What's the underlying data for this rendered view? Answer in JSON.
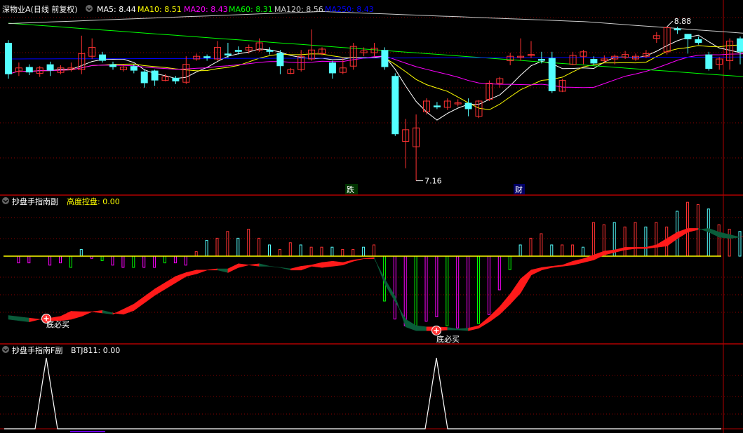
{
  "colors": {
    "up": "#ff3232",
    "down": "#54ffff",
    "ma5": "#ffffff",
    "ma10": "#ffff00",
    "ma20": "#ff00ff",
    "ma60": "#00ff00",
    "ma120": "#cccccc",
    "ma250": "#0000ff",
    "grid": "#8b0000",
    "title": "#ffffff"
  },
  "main": {
    "stock_name": "深物业A(日线 前复权)",
    "ma": [
      {
        "label": "MA5: 8.44",
        "color": "#ffffff"
      },
      {
        "label": "MA10: 8.51",
        "color": "#ffff00"
      },
      {
        "label": "MA20: 8.43",
        "color": "#ff00ff"
      },
      {
        "label": "MA60: 8.31",
        "color": "#00ff00"
      },
      {
        "label": "MA120: 8.56",
        "color": "#cccccc"
      },
      {
        "label": "MA250: 8.43",
        "color": "#0000ff"
      }
    ],
    "high_marker": "8.88",
    "low_marker": "7.16",
    "event_1": "跌",
    "event_2": "财"
  },
  "sub1": {
    "title": "抄盘手指南副",
    "value_label": "高度控盘: 0.00",
    "signal_1": "底必买",
    "signal_2": "底必买"
  },
  "sub2": {
    "title": "抄盘手指南F副",
    "value_label": "BTJ811: 0.00"
  },
  "chart_data": {
    "type": "candlestick",
    "price_range": [
      7.0,
      9.1
    ],
    "candles": [
      [
        8.7,
        8.35,
        8.73,
        8.3
      ],
      [
        8.38,
        8.42,
        8.48,
        8.33
      ],
      [
        8.43,
        8.37,
        8.46,
        8.34
      ],
      [
        8.36,
        8.42,
        8.44,
        8.32
      ],
      [
        8.46,
        8.39,
        8.49,
        8.33
      ],
      [
        8.37,
        8.42,
        8.45,
        8.35
      ],
      [
        8.4,
        8.42,
        8.48,
        8.38
      ],
      [
        8.4,
        8.58,
        8.78,
        8.35
      ],
      [
        8.55,
        8.65,
        8.75,
        8.52
      ],
      [
        8.57,
        8.5,
        8.6,
        8.48
      ],
      [
        8.46,
        8.43,
        8.49,
        8.4
      ],
      [
        8.4,
        8.43,
        8.46,
        8.38
      ],
      [
        8.44,
        8.39,
        8.46,
        8.36
      ],
      [
        8.38,
        8.25,
        8.4,
        8.2
      ],
      [
        8.39,
        8.28,
        8.4,
        8.22
      ],
      [
        8.28,
        8.32,
        8.35,
        8.27
      ],
      [
        8.31,
        8.27,
        8.33,
        8.24
      ],
      [
        8.26,
        8.46,
        8.55,
        8.24
      ],
      [
        8.52,
        8.55,
        8.58,
        8.5
      ],
      [
        8.55,
        8.53,
        8.57,
        8.5
      ],
      [
        8.52,
        8.65,
        8.72,
        8.5
      ],
      [
        8.58,
        8.56,
        8.7,
        8.53
      ],
      [
        8.62,
        8.6,
        8.66,
        8.57
      ],
      [
        8.62,
        8.65,
        8.68,
        8.58
      ],
      [
        8.62,
        8.7,
        8.75,
        8.6
      ],
      [
        8.62,
        8.6,
        8.65,
        8.57
      ],
      [
        8.59,
        8.44,
        8.62,
        8.35
      ],
      [
        8.36,
        8.4,
        8.42,
        8.35
      ],
      [
        8.4,
        8.55,
        8.62,
        8.38
      ],
      [
        8.52,
        8.62,
        8.85,
        8.5
      ],
      [
        8.58,
        8.63,
        8.65,
        8.56
      ],
      [
        8.48,
        8.36,
        8.5,
        8.3
      ],
      [
        8.37,
        8.42,
        8.53,
        8.35
      ],
      [
        8.44,
        8.66,
        8.7,
        8.4
      ],
      [
        8.59,
        8.61,
        8.65,
        8.55
      ],
      [
        8.59,
        8.64,
        8.7,
        8.55
      ],
      [
        8.62,
        8.43,
        8.65,
        8.4
      ],
      [
        8.33,
        7.68,
        8.36,
        7.66
      ],
      [
        7.6,
        7.73,
        7.85,
        7.3
      ],
      [
        7.54,
        7.75,
        7.9,
        7.16
      ],
      [
        7.93,
        8.05,
        8.08,
        7.9
      ],
      [
        8.0,
        7.98,
        8.04,
        7.96
      ],
      [
        7.98,
        8.05,
        8.08,
        7.95
      ],
      [
        8.03,
        8.03,
        8.07,
        7.99
      ],
      [
        8.03,
        7.96,
        8.08,
        7.88
      ],
      [
        7.88,
        8.05,
        8.06,
        7.86
      ],
      [
        8.07,
        8.25,
        8.28,
        8.05
      ],
      [
        8.25,
        8.3,
        8.32,
        8.2
      ],
      [
        8.5,
        8.55,
        8.59,
        8.45
      ],
      [
        8.55,
        8.55,
        8.75,
        8.5
      ],
      [
        8.56,
        8.57,
        8.72,
        8.53
      ],
      [
        8.52,
        8.5,
        8.6,
        8.47
      ],
      [
        8.53,
        8.16,
        8.6,
        8.14
      ],
      [
        8.16,
        8.28,
        8.3,
        8.15
      ],
      [
        8.46,
        8.56,
        8.6,
        8.45
      ],
      [
        8.55,
        8.6,
        8.62,
        8.46
      ],
      [
        8.52,
        8.47,
        8.55,
        8.45
      ],
      [
        8.5,
        8.52,
        8.56,
        8.48
      ],
      [
        8.52,
        8.55,
        8.57,
        8.46
      ],
      [
        8.54,
        8.57,
        8.61,
        8.52
      ],
      [
        8.52,
        8.55,
        8.58,
        8.5
      ],
      [
        8.55,
        8.58,
        8.62,
        8.53
      ],
      [
        8.75,
        8.78,
        8.82,
        8.7
      ],
      [
        8.6,
        8.87,
        8.88,
        8.57
      ],
      [
        8.86,
        8.84,
        8.88,
        8.8
      ],
      [
        8.8,
        8.74,
        8.8,
        8.58
      ],
      [
        8.74,
        8.7,
        8.77,
        8.68
      ],
      [
        8.57,
        8.41,
        8.6,
        8.39
      ],
      [
        8.46,
        8.52,
        8.54,
        8.4
      ],
      [
        8.5,
        8.72,
        8.75,
        8.4
      ],
      [
        8.75,
        8.6,
        8.77,
        8.46
      ],
      [
        8.62,
        8.68,
        8.72,
        8.55
      ]
    ],
    "sub1_histogram": [
      0,
      -0.3,
      -0.3,
      0,
      -0.4,
      -0.3,
      -0.5,
      0.3,
      -0.1,
      -0.2,
      -0.4,
      -0.5,
      -0.5,
      -0.5,
      -0.5,
      -0.3,
      -0.3,
      -0.4,
      0.2,
      0.7,
      0.8,
      1.1,
      0.8,
      1.2,
      0.8,
      0.5,
      0.3,
      0.6,
      0.5,
      0.4,
      0.4,
      0.4,
      0.3,
      0.3,
      0.4,
      0.5,
      -2.0,
      -2.8,
      -3.1,
      -3.1,
      -2.9,
      -2.7,
      -3.1,
      -3.2,
      -3.3,
      -3.0,
      -2.6,
      -1.5,
      -0.6,
      0.5,
      0.8,
      1.0,
      0.5,
      0.5,
      0.5,
      0.4,
      1.5,
      1.4,
      1.5,
      1.3,
      1.5,
      1.3,
      1.5,
      1.3,
      2.0,
      2.4,
      2.3,
      2.1,
      1.4,
      1.2,
      1.1,
      1.1,
      1.2
    ],
    "sub1_band": [
      [
        -2.35,
        -2.5
      ],
      [
        -2.4,
        -2.55
      ],
      [
        -2.45,
        -2.6
      ],
      [
        -2.5,
        -2.5
      ],
      [
        -2.45,
        -2.55
      ],
      [
        -2.38,
        -2.55
      ],
      [
        -2.18,
        -2.5
      ],
      [
        -2.2,
        -2.38
      ],
      [
        -2.2,
        -2.2
      ],
      [
        -2.25,
        -2.15
      ],
      [
        -2.3,
        -2.25
      ],
      [
        -2.1,
        -2.3
      ],
      [
        -1.9,
        -2.15
      ],
      [
        -1.6,
        -1.85
      ],
      [
        -1.3,
        -1.55
      ],
      [
        -1.05,
        -1.3
      ],
      [
        -0.8,
        -1.05
      ],
      [
        -0.65,
        -0.8
      ],
      [
        -0.55,
        -0.7
      ],
      [
        -0.55,
        -0.55
      ],
      [
        -0.5,
        -0.55
      ],
      [
        -0.5,
        -0.65
      ],
      [
        -0.3,
        -0.45
      ],
      [
        -0.35,
        -0.35
      ],
      [
        -0.3,
        -0.4
      ],
      [
        -0.4,
        -0.4
      ],
      [
        -0.45,
        -0.45
      ],
      [
        -0.5,
        -0.55
      ],
      [
        -0.4,
        -0.55
      ],
      [
        -0.35,
        -0.4
      ],
      [
        -0.25,
        -0.45
      ],
      [
        -0.2,
        -0.4
      ],
      [
        -0.25,
        -0.35
      ],
      [
        -0.15,
        -0.2
      ],
      [
        -0.1,
        -0.1
      ],
      [
        -0.05,
        -0.1
      ],
      [
        -1.1,
        -0.9
      ],
      [
        -1.8,
        -1.6
      ],
      [
        -2.5,
        -2.8
      ],
      [
        -2.75,
        -2.95
      ],
      [
        -2.8,
        -2.95
      ],
      [
        -2.8,
        -2.95
      ],
      [
        -2.82,
        -2.92
      ],
      [
        -2.88,
        -2.92
      ],
      [
        -2.85,
        -2.95
      ],
      [
        -2.75,
        -2.85
      ],
      [
        -2.4,
        -2.6
      ],
      [
        -2.0,
        -2.3
      ],
      [
        -1.5,
        -1.9
      ],
      [
        -0.9,
        -1.45
      ],
      [
        -0.55,
        -0.75
      ],
      [
        -0.45,
        -0.55
      ],
      [
        -0.4,
        -0.45
      ],
      [
        -0.35,
        -0.4
      ],
      [
        -0.2,
        -0.35
      ],
      [
        -0.1,
        -0.25
      ],
      [
        0.05,
        -0.15
      ],
      [
        0.2,
        0.05
      ],
      [
        0.25,
        0.15
      ],
      [
        0.35,
        0.25
      ],
      [
        0.35,
        0.3
      ],
      [
        0.35,
        0.3
      ],
      [
        0.45,
        0.35
      ],
      [
        0.7,
        0.4
      ],
      [
        0.95,
        0.7
      ],
      [
        1.1,
        0.95
      ],
      [
        1.1,
        1.05
      ],
      [
        0.95,
        1.1
      ],
      [
        0.75,
        0.95
      ],
      [
        0.7,
        0.85
      ],
      [
        0.75,
        0.75
      ],
      [
        0.8,
        0.8
      ],
      [
        0.85,
        0.8
      ]
    ],
    "sub2_values": [
      0,
      0,
      0,
      0,
      0,
      1,
      0,
      0,
      0,
      0,
      0,
      0,
      0,
      0,
      0,
      0,
      0,
      0,
      0,
      0,
      0,
      0,
      0,
      0,
      0,
      0,
      0,
      0,
      0,
      0,
      0,
      0,
      0,
      0,
      0,
      0,
      0,
      0,
      0,
      0,
      0,
      0,
      0,
      0,
      0,
      0,
      0,
      0,
      0,
      0,
      0,
      0,
      0,
      0,
      0,
      0,
      0,
      0,
      0,
      0,
      0,
      0,
      0,
      0,
      0,
      0,
      0,
      0,
      0,
      0,
      0,
      0
    ]
  }
}
